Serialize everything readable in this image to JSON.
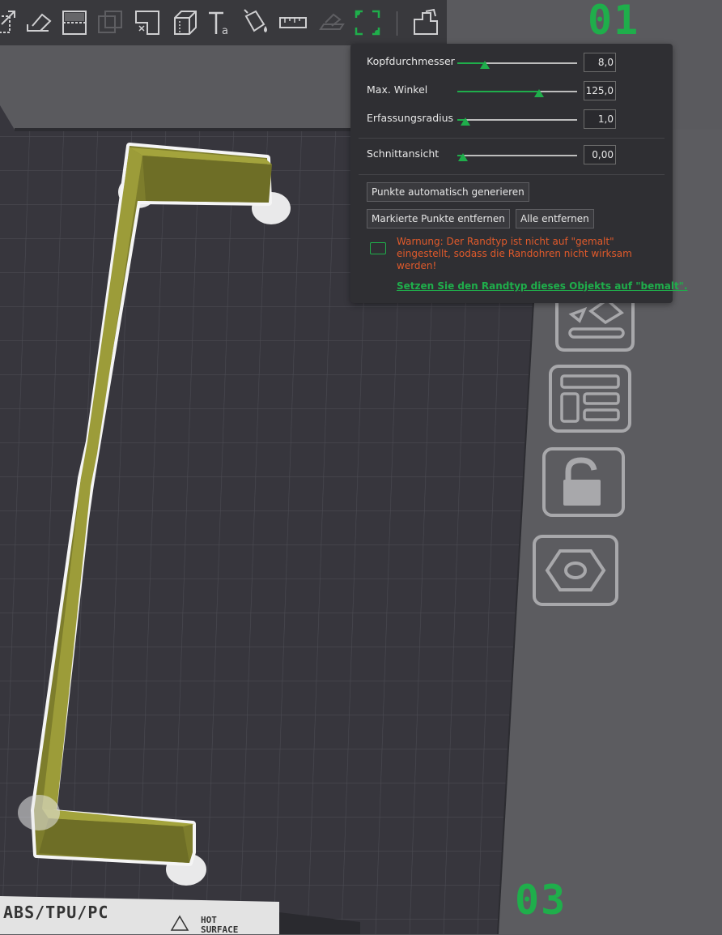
{
  "plate_labels": {
    "top": "01",
    "bottom": "03"
  },
  "bed_label": {
    "filaments": "ABS/TPU/PC",
    "hot_line1": "HOT",
    "hot_line2": "SURFACE"
  },
  "toolbar": {
    "tools": [
      {
        "name": "scale-icon"
      },
      {
        "name": "place-on-face-icon"
      },
      {
        "name": "cut-icon"
      },
      {
        "name": "boolean-icon"
      },
      {
        "name": "supports-paint-icon"
      },
      {
        "name": "seam-paint-icon"
      },
      {
        "name": "text-icon"
      },
      {
        "name": "color-paint-icon"
      },
      {
        "name": "measure-icon"
      },
      {
        "name": "assembly-icon"
      },
      {
        "name": "brim-ears-icon"
      },
      {
        "name": "arrange-icon"
      }
    ]
  },
  "panel": {
    "sliders": [
      {
        "label": "Kopfdurchmesser",
        "value": "8,0",
        "fraction": 0.23
      },
      {
        "label": "Max. Winkel",
        "value": "125,0",
        "fraction": 0.68
      },
      {
        "label": "Erfassungsradius",
        "value": "1,0",
        "fraction": 0.07
      },
      {
        "label": "Schnittansicht",
        "value": "0,00",
        "fraction": 0.05
      }
    ],
    "buttons": {
      "auto_generate": "Punkte automatisch generieren",
      "remove_selected": "Markierte Punkte entfernen",
      "remove_all": "Alle entfernen"
    },
    "warning": "Warnung: Der Randtyp ist nicht auf \"gemalt\" eingestellt, sodass die Randohren nicht wirksam werden!",
    "warning_link": "Setzen Sie den Randtyp dieses Objekts auf \"bemalt\"."
  },
  "colors": {
    "accent": "#1fae4b",
    "warning": "#e05a2b",
    "plate": "#38373f",
    "model": "#7d7d2c"
  }
}
